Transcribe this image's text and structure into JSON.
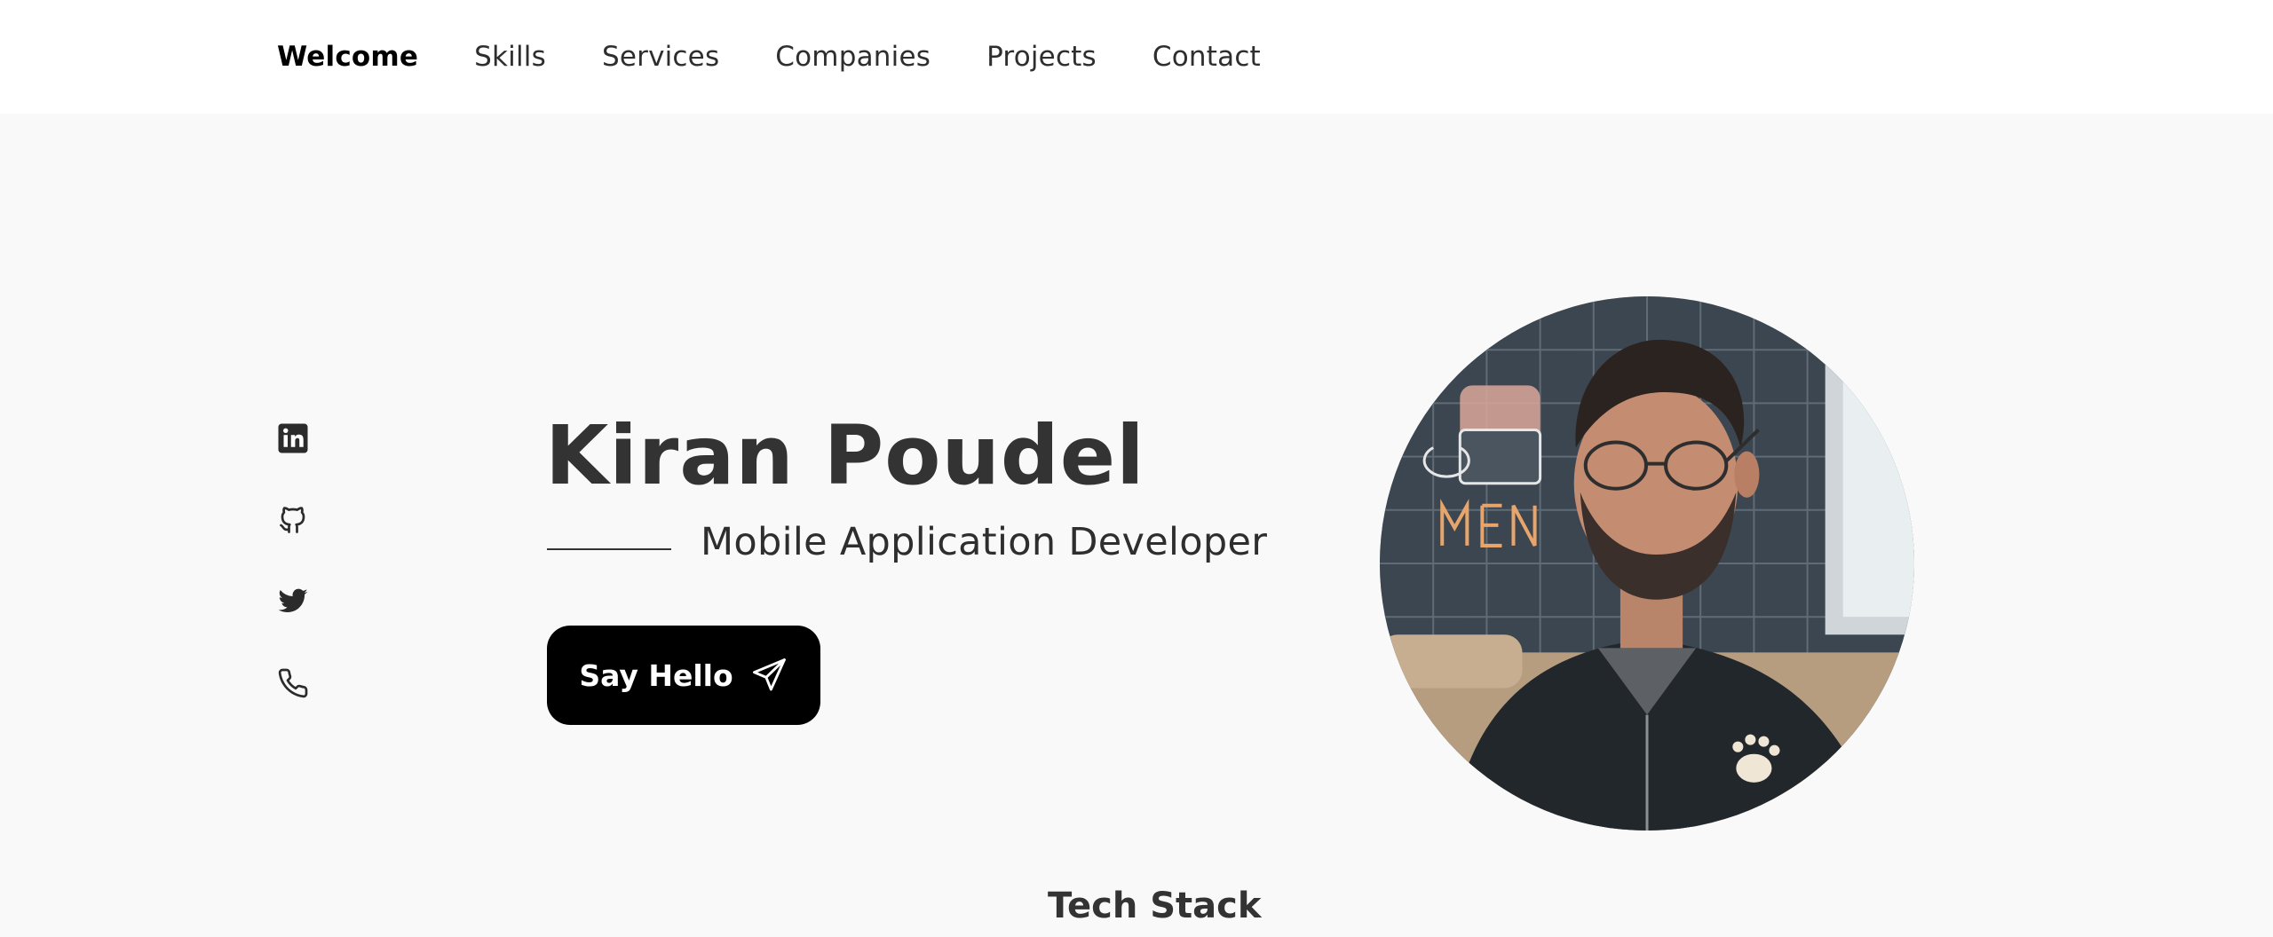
{
  "nav": {
    "items": [
      {
        "label": "Welcome",
        "active": true
      },
      {
        "label": "Skills",
        "active": false
      },
      {
        "label": "Services",
        "active": false
      },
      {
        "label": "Companies",
        "active": false
      },
      {
        "label": "Projects",
        "active": false
      },
      {
        "label": "Contact",
        "active": false
      }
    ]
  },
  "social": {
    "icons": [
      "linkedin-icon",
      "github-icon",
      "twitter-icon",
      "phone-icon"
    ]
  },
  "hero": {
    "name": "Kiran Poudel",
    "role": "Mobile Application Developer",
    "cta_label": "Say Hello",
    "cta_icon": "send-icon"
  },
  "sections": {
    "tech_stack_title": "Tech Stack"
  },
  "colors": {
    "background": "#f9f9f9",
    "navbar": "#ffffff",
    "button": "#000000",
    "text": "#2b2b2b"
  }
}
